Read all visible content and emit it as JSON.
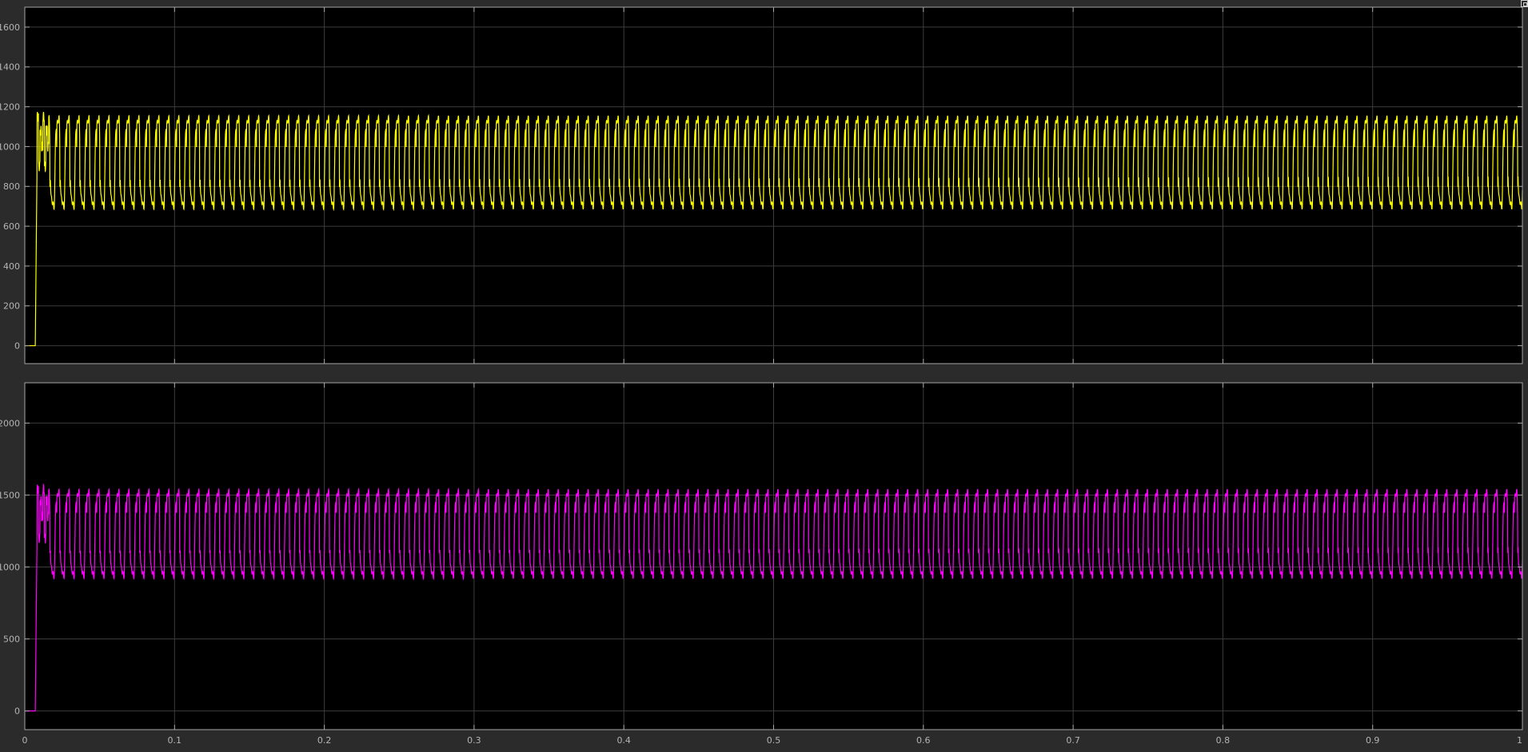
{
  "window": {
    "restore_label": ""
  },
  "colors": {
    "figure_background": "#2b2b2b",
    "axes_background": "#000000",
    "grid": "#3c3c3c",
    "axes_border": "#a6a6a6",
    "tick_text": "#b4b4b4"
  },
  "chart_data": [
    {
      "type": "line",
      "title": "",
      "xlabel": "",
      "ylabel": "",
      "xlim": [
        0,
        1
      ],
      "ylim": [
        -90,
        1700
      ],
      "x_ticks": [
        0,
        0.1,
        0.2,
        0.3,
        0.4,
        0.5,
        0.6,
        0.7,
        0.8,
        0.9,
        1
      ],
      "x_tick_labels": [
        "",
        "",
        "",
        "",
        "",
        "",
        "",
        "",
        "",
        "",
        ""
      ],
      "y_ticks": [
        0,
        200,
        400,
        600,
        800,
        1000,
        1200,
        1400,
        1600
      ],
      "y_tick_labels": [
        "0",
        "200",
        "400",
        "600",
        "800",
        "1000",
        "1200",
        "1400",
        "1600"
      ],
      "grid": true,
      "legend": "none",
      "series": [
        {
          "color": "#ffff00",
          "waveform": "periodic",
          "start_time": 0.007,
          "initial_value": 0,
          "period": 0.006667,
          "max": 1230,
          "min": 610,
          "mean": 920,
          "secondary_levels": [
            800,
            1000
          ],
          "transient_values": [
            1150,
            900,
            1080,
            1000
          ]
        }
      ]
    },
    {
      "type": "line",
      "title": "",
      "xlabel": "",
      "ylabel": "",
      "xlim": [
        0,
        1
      ],
      "ylim": [
        -130,
        2280
      ],
      "x_ticks": [
        0,
        0.1,
        0.2,
        0.3,
        0.4,
        0.5,
        0.6,
        0.7,
        0.8,
        0.9,
        1
      ],
      "x_tick_labels": [
        "0",
        "0.1",
        "0.2",
        "0.3",
        "0.4",
        "0.5",
        "0.6",
        "0.7",
        "0.8",
        "0.9",
        "1"
      ],
      "y_ticks": [
        0,
        500,
        1000,
        1500,
        2000
      ],
      "y_tick_labels": [
        "0",
        "500",
        "1000",
        "1500",
        "2000"
      ],
      "grid": true,
      "legend": "none",
      "series": [
        {
          "color": "#ff00ff",
          "waveform": "periodic",
          "start_time": 0.007,
          "initial_value": 0,
          "period": 0.006667,
          "max": 1640,
          "min": 820,
          "mean": 1230,
          "secondary_levels": [
            1100,
            1380
          ],
          "transient_values": [
            1540,
            1200,
            1460,
            1350
          ]
        }
      ]
    }
  ]
}
